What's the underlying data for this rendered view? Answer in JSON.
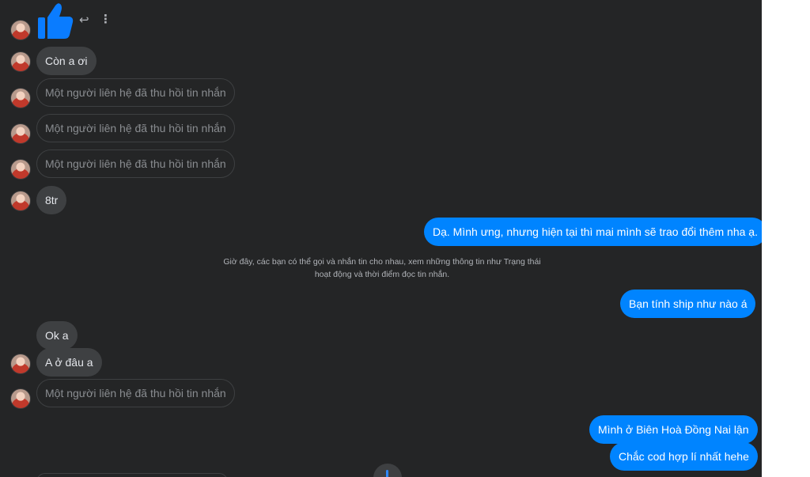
{
  "messages": {
    "con_a_oi": "Còn a ơi",
    "recalled": "Một người liên hệ đã thu hồi tin nhắn",
    "tr8": "8tr",
    "da_minh_ung": "Dạ. Mình ưng, nhưng hiện tại thì mai mình sẽ trao đổi thêm nha ạ.",
    "system_line1": "Giờ đây, các bạn có thể gọi và nhắn tin cho nhau, xem những thông tin như Trạng thái",
    "system_line2": "hoạt động và thời điểm đọc tin nhắn.",
    "ban_tinh_ship": "Bạn tính ship như nào á",
    "ok_a": "Ok a",
    "a_o_dau_a": "A ở đâu a",
    "minh_o_bien_hoa": "Mình ở Biên Hoà Đồng Nai lận",
    "chac_cod": "Chắc cod hợp lí nhất hehe"
  },
  "colors": {
    "background": "#242526",
    "incoming_bubble": "#3e4042",
    "outgoing_bubble": "#0084ff",
    "like": "#0a7cff"
  },
  "icons": {
    "like": "thumbs-up-icon",
    "reply": "reply-icon",
    "more": "more-vertical-icon",
    "scroll": "scroll-down-icon"
  }
}
